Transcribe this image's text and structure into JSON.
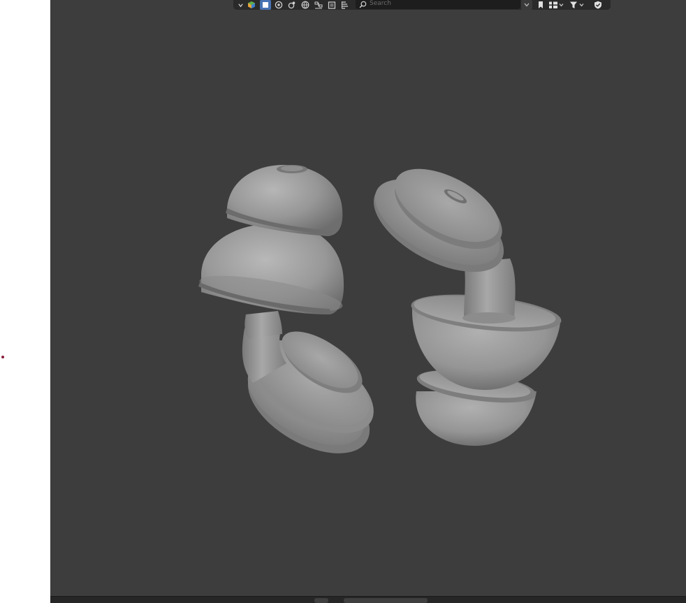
{
  "header": {
    "search": {
      "placeholder": "Search",
      "value": ""
    },
    "icons": [
      "chevron-down-icon",
      "display-mode-icon",
      "object-icon",
      "scene-icon",
      "material-icon",
      "world-icon",
      "node-icon",
      "library-icon",
      "stack-icon",
      "search-icon",
      "collapse-icon",
      "bookmark-icon",
      "view-mode-icon",
      "filter-icon",
      "shield-check-icon"
    ]
  },
  "viewport": {
    "background": "#3d3d3d",
    "objects": [
      "left-earplug",
      "right-earplug"
    ],
    "material_color": "#9a9a9a"
  },
  "colors": {
    "accent": "#4772b3",
    "header_bg": "#2a2a2a",
    "left_marker": "#8a1f3c"
  }
}
